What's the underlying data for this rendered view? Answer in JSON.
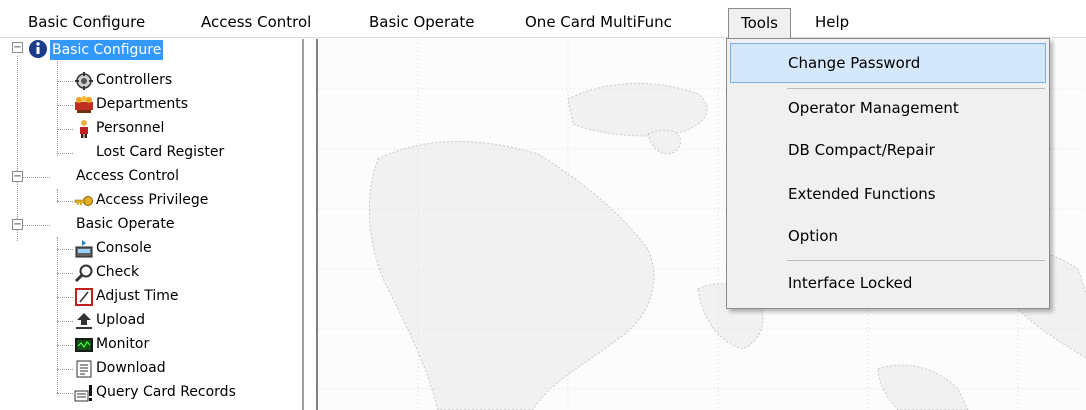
{
  "menubar": {
    "basic_configure": "Basic Configure",
    "access_control": "Access Control",
    "basic_operate": "Basic Operate",
    "one_card_multifunc": "One Card MultiFunc",
    "tools": "Tools",
    "help": "Help"
  },
  "tree": {
    "basic_configure": "Basic Configure",
    "controllers": "Controllers",
    "departments": "Departments",
    "personnel": "Personnel",
    "lost_card_register": "Lost Card Register",
    "access_control": "Access Control",
    "access_privilege": "Access Privilege",
    "basic_operate": "Basic Operate",
    "console": "Console",
    "check": "Check",
    "adjust_time": "Adjust Time",
    "upload": "Upload",
    "monitor": "Monitor",
    "download": "Download",
    "query_card_records": "Query Card Records"
  },
  "tools_menu": {
    "change_password": "Change Password",
    "operator_management": "Operator Management",
    "db_compact_repair": "DB Compact/Repair",
    "extended_functions": "Extended Functions",
    "option": "Option",
    "interface_locked": "Interface Locked"
  }
}
